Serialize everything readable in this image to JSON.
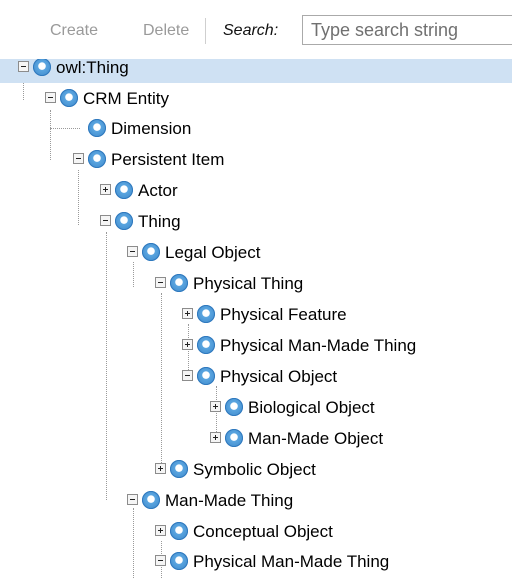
{
  "toolbar": {
    "create_label": "Create",
    "delete_label": "Delete",
    "search_label": "Search:",
    "search_placeholder": "Type search string",
    "search_value": ""
  },
  "tree": {
    "nodes": [
      {
        "label": "owl:Thing",
        "expander": "minus",
        "selected": true
      },
      {
        "label": "CRM Entity",
        "expander": "minus"
      },
      {
        "label": "Dimension",
        "expander": "none"
      },
      {
        "label": "Persistent Item",
        "expander": "minus"
      },
      {
        "label": "Actor",
        "expander": "plus"
      },
      {
        "label": "Thing",
        "expander": "minus"
      },
      {
        "label": "Legal Object",
        "expander": "minus"
      },
      {
        "label": "Physical Thing",
        "expander": "minus"
      },
      {
        "label": "Physical Feature",
        "expander": "plus"
      },
      {
        "label": "Physical Man-Made Thing",
        "expander": "plus"
      },
      {
        "label": "Physical Object",
        "expander": "minus"
      },
      {
        "label": "Biological Object",
        "expander": "plus"
      },
      {
        "label": "Man-Made Object",
        "expander": "plus"
      },
      {
        "label": "Symbolic Object",
        "expander": "plus"
      },
      {
        "label": "Man-Made Thing",
        "expander": "minus"
      },
      {
        "label": "Conceptual Object",
        "expander": "plus"
      },
      {
        "label": "Physical Man-Made Thing",
        "expander": "minus"
      }
    ]
  },
  "colors": {
    "selection": "#cfe1f3",
    "node_icon": "#3b86c8"
  }
}
